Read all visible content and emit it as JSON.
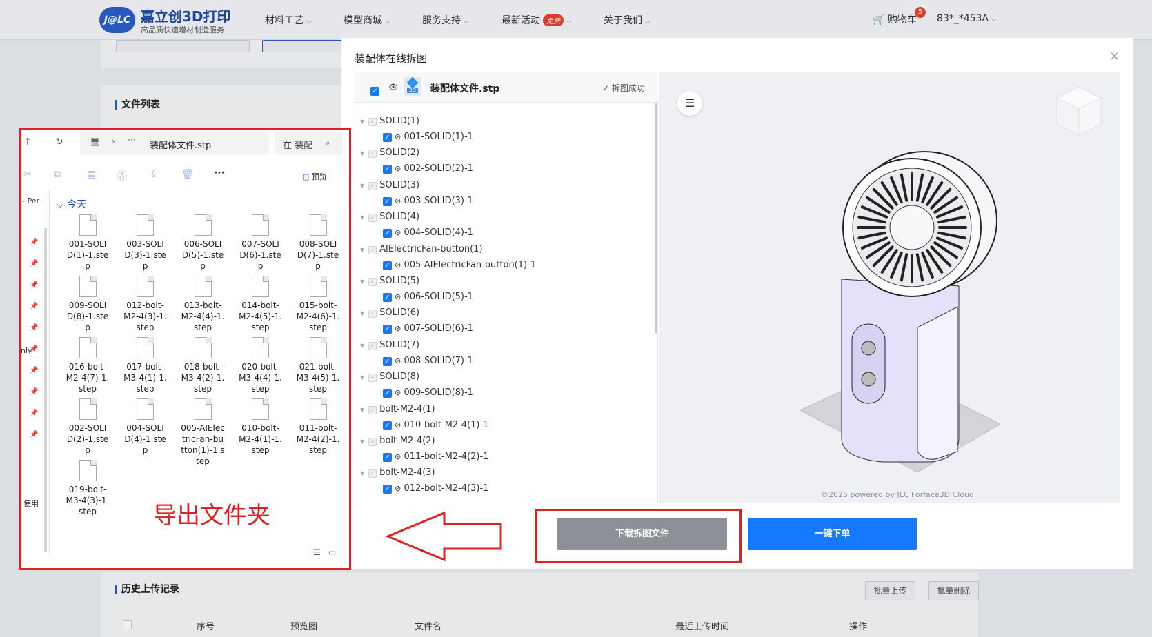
{
  "nav": {
    "logo_mark": "J@LC",
    "brand": "嘉立创3D打印",
    "tagline": "高品质快速增材制造服务",
    "items": [
      "材料工艺",
      "模型商城",
      "服务支持",
      "最新活动",
      "关于我们"
    ],
    "free_tag": "免费",
    "cart": "购物车",
    "cart_count": "5",
    "user": "83*_*453A"
  },
  "page": {
    "file_list_title": "文件列表",
    "history_title": "历史上传记录",
    "batch_upload": "批量上传",
    "batch_delete": "批量删除",
    "columns": [
      "序号",
      "预览图",
      "文件名",
      "最近上传时间",
      "操作"
    ]
  },
  "modal": {
    "title": "装配体在线拆图",
    "close": "×",
    "file_name": "装配体文件.stp",
    "file_badge": "3D",
    "status": "拆图成功",
    "tree": [
      {
        "group": "SOLID(1)",
        "child": "001-SOLID(1)-1"
      },
      {
        "group": "SOLID(2)",
        "child": "002-SOLID(2)-1"
      },
      {
        "group": "SOLID(3)",
        "child": "003-SOLID(3)-1"
      },
      {
        "group": "SOLID(4)",
        "child": "004-SOLID(4)-1"
      },
      {
        "group": "AIElectricFan-button(1)",
        "child": "005-AIElectricFan-button(1)-1"
      },
      {
        "group": "SOLID(5)",
        "child": "006-SOLID(5)-1"
      },
      {
        "group": "SOLID(6)",
        "child": "007-SOLID(6)-1"
      },
      {
        "group": "SOLID(7)",
        "child": "008-SOLID(7)-1"
      },
      {
        "group": "SOLID(8)",
        "child": "009-SOLID(8)-1"
      },
      {
        "group": "bolt-M2-4(1)",
        "child": "010-bolt-M2-4(1)-1"
      },
      {
        "group": "bolt-M2-4(2)",
        "child": "011-bolt-M2-4(2)-1"
      },
      {
        "group": "bolt-M2-4(3)",
        "child": "012-bolt-M2-4(3)-1"
      }
    ],
    "credit": "©2025 powered by JLC Forface3D Cloud",
    "download_btn": "下载拆图文件",
    "order_btn": "一键下单"
  },
  "explorer": {
    "path_file": "装配体文件.stp",
    "search_placeholder": "在 装配",
    "preview": "预览",
    "group": "今天",
    "side_labels": [
      "- Per",
      "nly",
      "使用"
    ],
    "files": [
      [
        "001-SOLI",
        "D(1)-1.ste",
        "p"
      ],
      [
        "003-SOLI",
        "D(3)-1.ste",
        "p"
      ],
      [
        "006-SOLI",
        "D(5)-1.ste",
        "p"
      ],
      [
        "007-SOLI",
        "D(6)-1.ste",
        "p"
      ],
      [
        "008-SOLI",
        "D(7)-1.ste",
        "p"
      ],
      [
        "009-SOLI",
        "D(8)-1.ste",
        "p"
      ],
      [
        "012-bolt-",
        "M2-4(3)-1.",
        "step"
      ],
      [
        "013-bolt-",
        "M2-4(4)-1.",
        "step"
      ],
      [
        "014-bolt-",
        "M2-4(5)-1.",
        "step"
      ],
      [
        "015-bolt-",
        "M2-4(6)-1.",
        "step"
      ],
      [
        "016-bolt-",
        "M2-4(7)-1.",
        "step"
      ],
      [
        "017-bolt-",
        "M3-4(1)-1.",
        "step"
      ],
      [
        "018-bolt-",
        "M3-4(2)-1.",
        "step"
      ],
      [
        "020-bolt-",
        "M3-4(4)-1.",
        "step"
      ],
      [
        "021-bolt-",
        "M3-4(5)-1.",
        "step"
      ],
      [
        "002-SOLI",
        "D(2)-1.ste",
        "p"
      ],
      [
        "004-SOLI",
        "D(4)-1.ste",
        "p"
      ],
      [
        "005-AIElec",
        "tricFan-bu",
        "tton(1)-1.s",
        "tep"
      ],
      [
        "010-bolt-",
        "M2-4(1)-1.",
        "step"
      ],
      [
        "011-bolt-",
        "M2-4(2)-1.",
        "step"
      ],
      [
        "019-bolt-",
        "M3-4(3)-1.",
        "step"
      ]
    ],
    "annotation": "导出文件夹"
  },
  "colors": {
    "accent": "#1677ff",
    "highlight": "#e02121",
    "brand": "#2a5ec7"
  }
}
